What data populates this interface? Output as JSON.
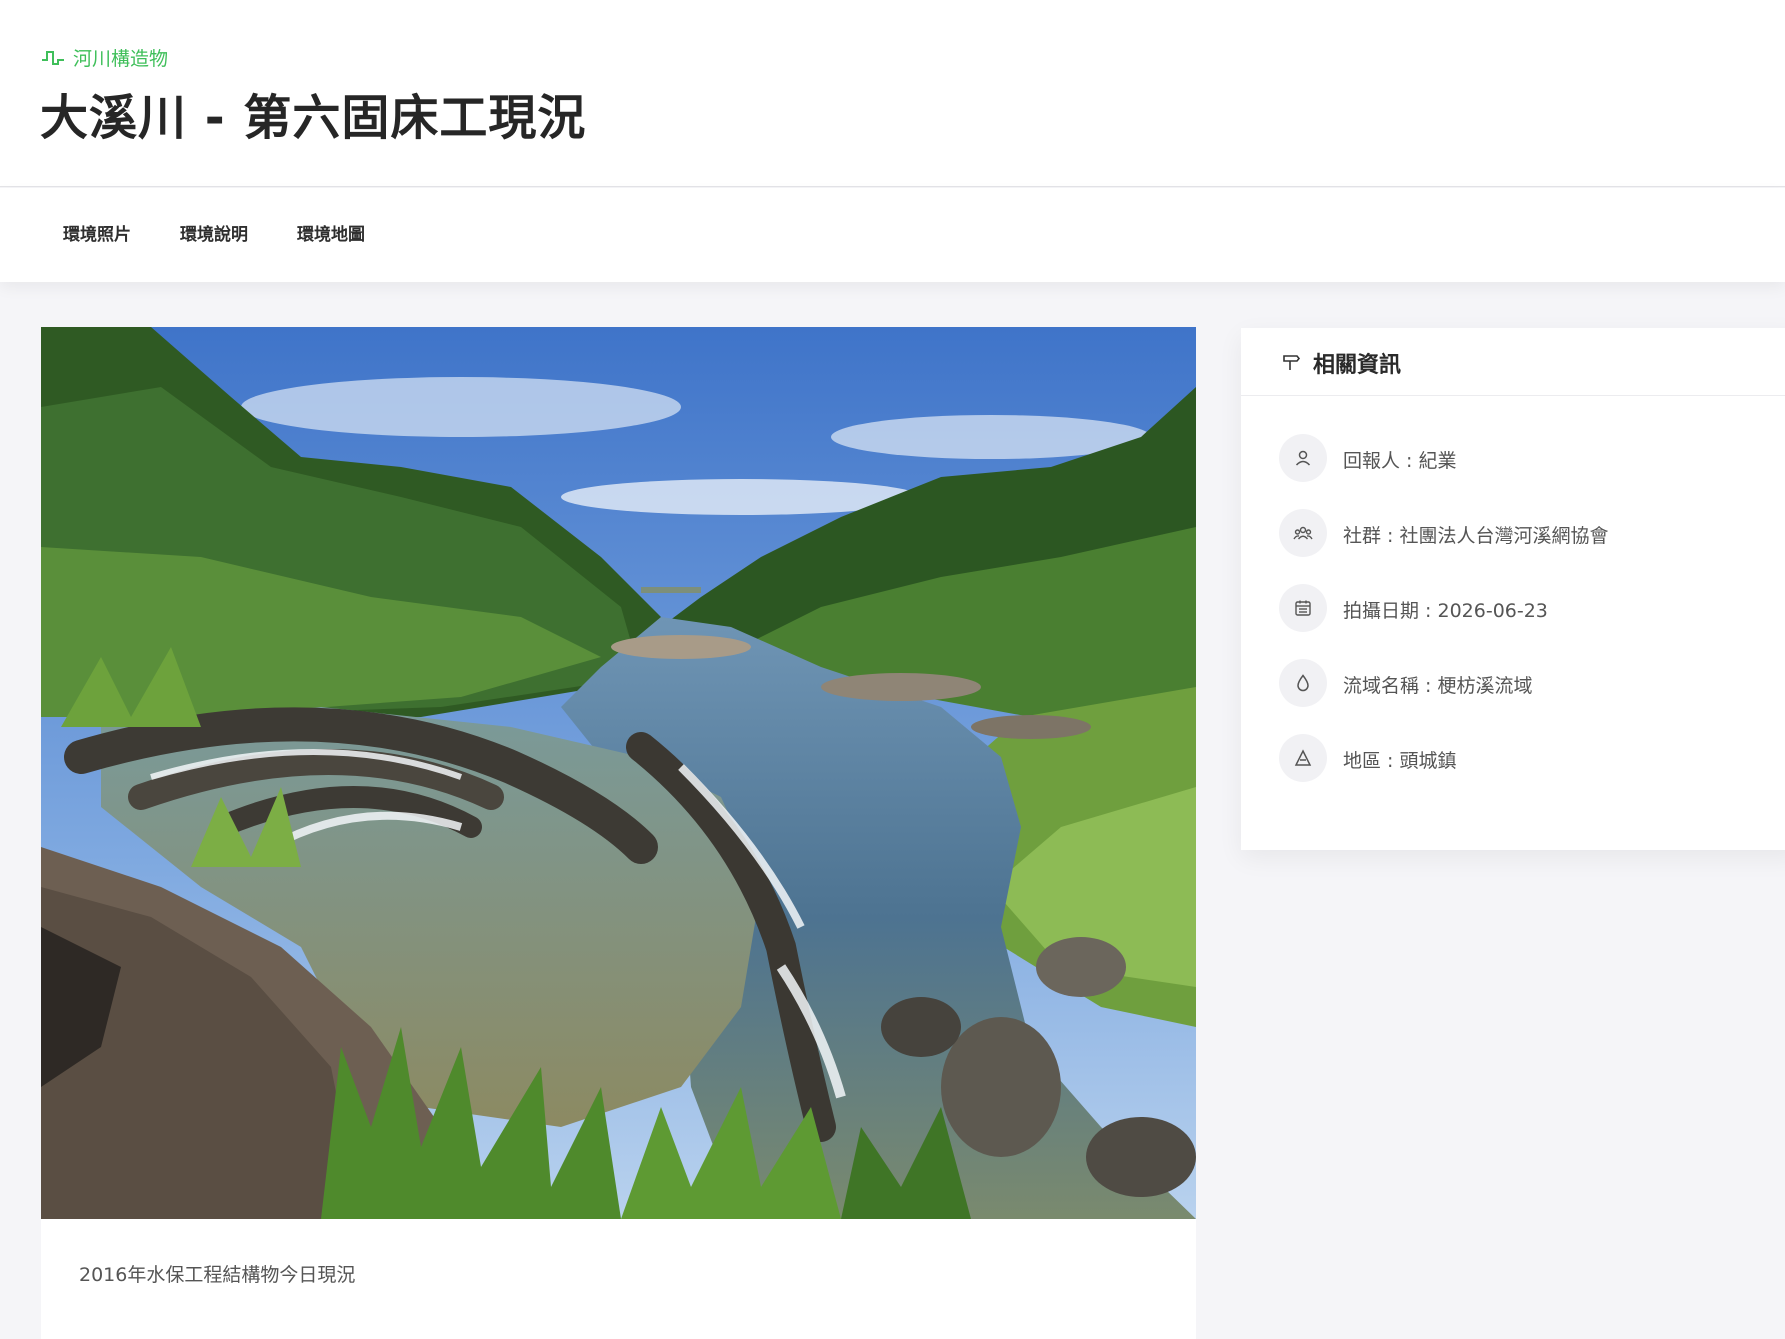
{
  "header": {
    "category_label": "河川構造物",
    "category_icon": "pulse-icon",
    "title": "大溪川 - 第六固床工現況",
    "accent_color": "#3fbf5a"
  },
  "tabs": [
    {
      "label": "環境照片"
    },
    {
      "label": "環境說明"
    },
    {
      "label": "環境地圖"
    }
  ],
  "photo": {
    "caption": "2016年水保工程結構物今日現況"
  },
  "info": {
    "title": "相關資訊",
    "title_icon": "signpost-icon",
    "items": [
      {
        "icon": "user-icon",
        "text": "回報人 : 紀業"
      },
      {
        "icon": "group-icon",
        "text": "社群 : 社團法人台灣河溪網協會"
      },
      {
        "icon": "calendar-icon",
        "text": "拍攝日期 : 2026-06-23"
      },
      {
        "icon": "water-drop-icon",
        "text": "流域名稱 : 梗枋溪流域"
      },
      {
        "icon": "mountain-icon",
        "text": "地區 : 頭城鎮"
      }
    ]
  }
}
